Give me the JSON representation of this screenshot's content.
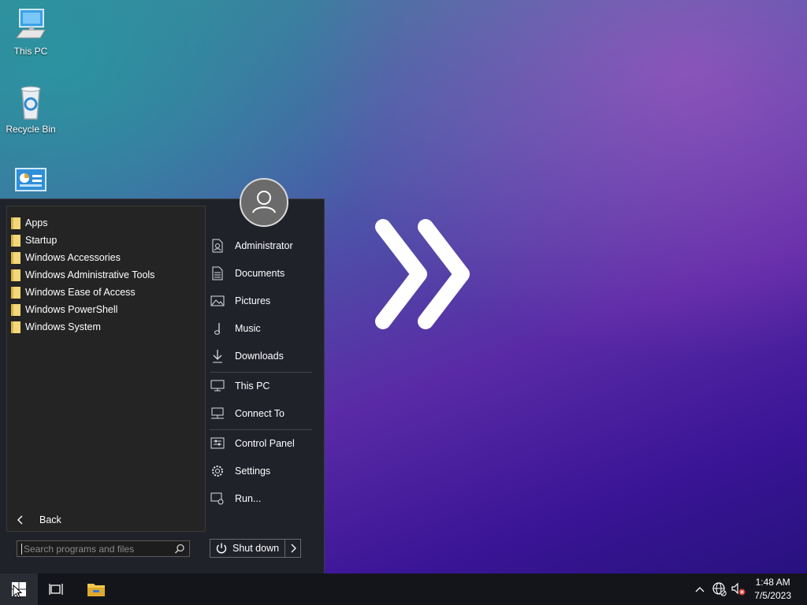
{
  "desktop": {
    "icons": [
      {
        "label": "This PC",
        "icon": "monitor-icon"
      },
      {
        "label": "Recycle Bin",
        "icon": "recycle-bin-icon"
      },
      {
        "label": "",
        "icon": "control-panel-icon"
      }
    ]
  },
  "start_menu": {
    "programs": [
      {
        "label": "Apps",
        "icon": "apps-folder-icon"
      },
      {
        "label": "Startup",
        "icon": "folder-icon"
      },
      {
        "label": "Windows Accessories",
        "icon": "folder-icon"
      },
      {
        "label": "Windows Administrative Tools",
        "icon": "folder-icon"
      },
      {
        "label": "Windows Ease of Access",
        "icon": "folder-icon"
      },
      {
        "label": "Windows PowerShell",
        "icon": "folder-icon"
      },
      {
        "label": "Windows System",
        "icon": "folder-icon"
      }
    ],
    "back_label": "Back",
    "search_placeholder": "Search programs and files",
    "right_items": [
      {
        "label": "Administrator",
        "icon": "user-folder-icon"
      },
      {
        "label": "Documents",
        "icon": "document-icon"
      },
      {
        "label": "Pictures",
        "icon": "picture-icon"
      },
      {
        "label": "Music",
        "icon": "music-note-icon"
      },
      {
        "label": "Downloads",
        "icon": "download-icon"
      },
      {
        "label": "This PC",
        "icon": "monitor-icon"
      },
      {
        "label": "Connect To",
        "icon": "network-icon"
      },
      {
        "label": "Control Panel",
        "icon": "control-panel-icon"
      },
      {
        "label": "Settings",
        "icon": "gear-icon"
      },
      {
        "label": "Run...",
        "icon": "run-icon"
      }
    ],
    "shutdown_label": "Shut down"
  },
  "taskbar": {
    "time": "1:48 AM",
    "date": "7/5/2023",
    "tray_icons": [
      "chevron-up-icon",
      "network-globe-icon",
      "volume-muted-icon"
    ]
  },
  "colors": {
    "menu_bg": "#20222a",
    "folder": "#f3d87a",
    "taskbar": "#14151b"
  }
}
